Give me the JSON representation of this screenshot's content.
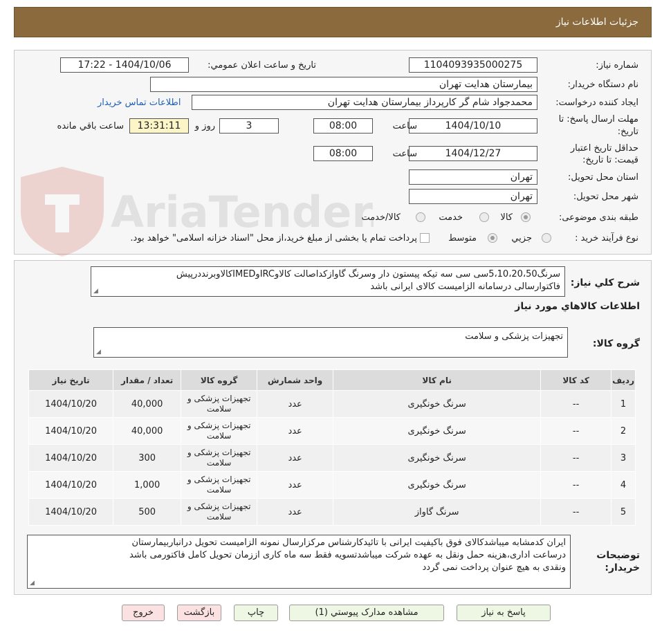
{
  "header": {
    "title": "جزئیات اطلاعات نیاز"
  },
  "watermark": {
    "text": "AriaTender.neT"
  },
  "form": {
    "need_no_label": "شماره نیاز:",
    "need_no": "1104093935000275",
    "announce_label": "تاریخ و ساعت اعلان عمومي:",
    "announce_value": "1404/10/06 - 17:22",
    "buyer_label": "نام دستگاه خریدار:",
    "buyer": "بیمارستان هدایت تهران",
    "creator_label": "ایجاد کننده درخواست:",
    "creator": "محمدجواد شام گر کارپرداز بیمارستان هدایت تهران",
    "contact_link": "اطلاعات تماس خریدار",
    "deadline_label_1": "مهلت ارسال پاسخ: تا",
    "deadline_label_2": "تاریخ:",
    "deadline_date": "1404/10/10",
    "time_label": "ساعت",
    "deadline_time": "08:00",
    "days": "3",
    "days_label": "روز و",
    "remaining": "13:31:11",
    "remaining_label": "ساعت باقي مانده",
    "validity_label_1": "حداقل تاریخ اعتبار",
    "validity_label_2": "قیمت: تا تاریخ:",
    "validity_date": "1404/12/27",
    "validity_time": "08:00",
    "province_label": "استان محل تحویل:",
    "province": "تهران",
    "city_label": "شهر محل تحویل:",
    "city": "تهران",
    "category_label": "طبقه بندی موضوعی:",
    "category_options": [
      "کالا",
      "خدمت",
      "کالا/خدمت"
    ],
    "process_label": "نوع فرآیند خرید :",
    "process_options": [
      "جزیي",
      "متوسط"
    ],
    "payment_note": "پرداخت تمام یا بخشی از مبلغ خرید،از محل \"اسناد خزانه اسلامی\" خواهد بود."
  },
  "description": {
    "label": "شرح کلي نیاز:",
    "line1": "سرنگ5،10،20،50سی سی سه تیکه پیستون دار وسرنگ گاوازکداصالت کالاوIRCوIMEDکالاوبرنددرپیش",
    "line2": "فاکتوارسالی درسامانه الزامیست کالای ایرانی باشد"
  },
  "goods": {
    "section_title": "اطلاعات کالاهاي مورد نیاز",
    "group_label": "گروه کالا:",
    "group_value": "تجهیزات پزشکی و سلامت",
    "columns": [
      "ردیف",
      "کد کالا",
      "نام کالا",
      "واحد شمارش",
      "گروه کالا",
      "تعداد / مقدار",
      "تاریخ نیاز"
    ],
    "rows": [
      {
        "row": "1",
        "code": "--",
        "name": "سرنگ خونگیری",
        "unit": "عدد",
        "group_1": "تجهیزات پزشکی و",
        "group_2": "سلامت",
        "qty": "40,000",
        "date": "1404/10/20"
      },
      {
        "row": "2",
        "code": "--",
        "name": "سرنگ خونگیری",
        "unit": "عدد",
        "group_1": "تجهیزات پزشکی و",
        "group_2": "سلامت",
        "qty": "40,000",
        "date": "1404/10/20"
      },
      {
        "row": "3",
        "code": "--",
        "name": "سرنگ خونگیری",
        "unit": "عدد",
        "group_1": "تجهیزات پزشکی و",
        "group_2": "سلامت",
        "qty": "300",
        "date": "1404/10/20"
      },
      {
        "row": "4",
        "code": "--",
        "name": "سرنگ خونگیری",
        "unit": "عدد",
        "group_1": "تجهیزات پزشکی و",
        "group_2": "سلامت",
        "qty": "1,000",
        "date": "1404/10/20"
      },
      {
        "row": "5",
        "code": "--",
        "name": "سرنگ گاواز",
        "unit": "عدد",
        "group_1": "تجهیزات پزشکی و",
        "group_2": "سلامت",
        "qty": "500",
        "date": "1404/10/20"
      }
    ],
    "notes_label_1": "توضیحات",
    "notes_label_2": "خریدار:",
    "notes_line1": "ایران کدمشابه میباشدکالای فوق باکیفیت ایرانی با تائیدکارشناس مرکزارسال نمونه الزامیست تحویل درانباربیمارستان",
    "notes_line2": "درساعت اداری،هزینه حمل ونقل به عهده شرکت میباشدتسویه فقط سه ماه کاری اززمان تحویل کامل فاکتورمی باشد",
    "notes_line3": "ونقدی به هیچ عنوان پرداخت نمی گردد"
  },
  "buttons": {
    "reply": "پاسخ به نیاز",
    "attachments": "مشاهده مدارک پیوستي (1)",
    "print": "چاپ",
    "back": "بازگشت",
    "exit": "خروج"
  },
  "colors": {
    "header_bg": "#8b6a3e",
    "link": "#1f5fb8",
    "remaining_bg": "#fbf5c8"
  }
}
